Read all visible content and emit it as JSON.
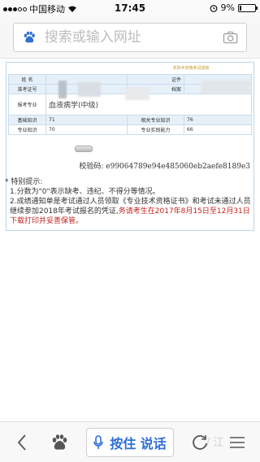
{
  "status_bar": {
    "carrier": "中国移动",
    "time": "17:45",
    "battery_percent": "9%",
    "battery_level": 0.09
  },
  "search": {
    "placeholder": "搜索或输入网址"
  },
  "certificate": {
    "header_text": "本技术资格考试成绩",
    "rows": {
      "name_label": "姓 名",
      "admission_label": "准考证号",
      "id_label": "证件",
      "archive_label": "档案",
      "major_label": "报考专业",
      "major_value": "血液病学(中级)",
      "basic_label": "基础知识",
      "basic_score": "71",
      "related_label": "相关专业知识",
      "related_score": "76",
      "professional_label": "专业知识",
      "professional_score": "70",
      "practice_label": "专业实践能力",
      "practice_score": "66"
    },
    "verify_label": "校验码:",
    "verify_code": "e99064789e94e485060eb2aefe8189e3"
  },
  "notes": {
    "title": "* 特别提示:",
    "item1": "1.分数为\"0\"表示缺考、违纪、不得分等情况。",
    "item2_prefix": "2.成绩通知单是考试通过人员领取《专业技术资格证书》和考试未通过人员继续参加2018年考试报名的凭证,",
    "item2_red": "务请考生在2017年8月15日至12月31日下载打印并妥善保管。"
  },
  "toolbar": {
    "voice_label": "按住 说话",
    "watermark": "/ 江",
    "back_icon": "back-chevron-icon",
    "home_icon": "baidu-paw-icon",
    "mic_icon": "microphone-icon",
    "refresh_icon": "refresh-icon",
    "menu_icon": "menu-icon"
  },
  "colors": {
    "accent_blue": "#2f6fd6",
    "notice_red": "#c0221d",
    "table_border": "#c9dcec"
  }
}
